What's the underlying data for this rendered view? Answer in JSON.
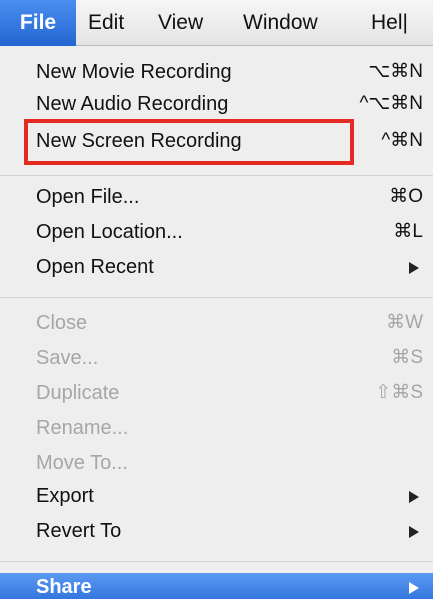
{
  "menubar": {
    "items": [
      {
        "label": "File"
      },
      {
        "label": "Edit"
      },
      {
        "label": "View"
      },
      {
        "label": "Window"
      },
      {
        "label": "Hel|"
      }
    ]
  },
  "menu": {
    "new_movie": {
      "label": "New Movie Recording",
      "shortcut": "⌥⌘N"
    },
    "new_audio": {
      "label": "New Audio Recording",
      "shortcut": "^⌥⌘N"
    },
    "new_screen": {
      "label": "New Screen Recording",
      "shortcut": "^⌘N"
    },
    "open_file": {
      "label": "Open File...",
      "shortcut": "⌘O"
    },
    "open_location": {
      "label": "Open Location...",
      "shortcut": "⌘L"
    },
    "open_recent": {
      "label": "Open Recent"
    },
    "close": {
      "label": "Close",
      "shortcut": "⌘W"
    },
    "save": {
      "label": "Save...",
      "shortcut": "⌘S"
    },
    "duplicate": {
      "label": "Duplicate",
      "shortcut": "⇧⌘S"
    },
    "rename": {
      "label": "Rename..."
    },
    "move_to": {
      "label": "Move To..."
    },
    "export": {
      "label": "Export"
    },
    "revert_to": {
      "label": "Revert To"
    },
    "share": {
      "label": "Share"
    }
  },
  "colors": {
    "highlight": "#2f71dc",
    "annotation": "#e52b21",
    "disabled_text": "#a6a6a6"
  }
}
